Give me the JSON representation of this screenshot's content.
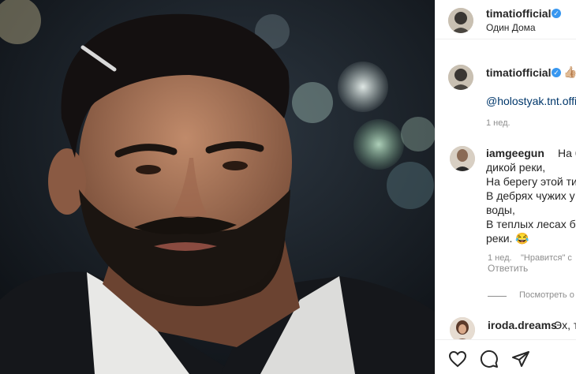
{
  "post": {
    "username": "timatiofficial",
    "location": "Один Дома"
  },
  "caption": {
    "username": "timatiofficial",
    "emoji": "👍🏼",
    "mention": "@holostyak.tnt.offi",
    "time": "1 нед."
  },
  "comments": [
    {
      "username": "iamgeegun",
      "lines": [
        "На б",
        "дикой реки,",
        "На берегу этой ти",
        "В дебрях чужих у",
        "воды,",
        "В теплых лесах бе",
        "реки. 😂"
      ],
      "time": "1 нед.",
      "likes": "\"Нравится\" с",
      "reply": "Ответить",
      "view_replies": "Посмотреть о"
    },
    {
      "username": "iroda.dreams",
      "text": "Эх, т"
    }
  ],
  "icons": [
    "verified-badge",
    "heart-icon",
    "comment-icon",
    "share-icon"
  ],
  "colors": {
    "verified": "#3897f0",
    "mention": "#00376b",
    "meta": "#8e8e8e"
  }
}
